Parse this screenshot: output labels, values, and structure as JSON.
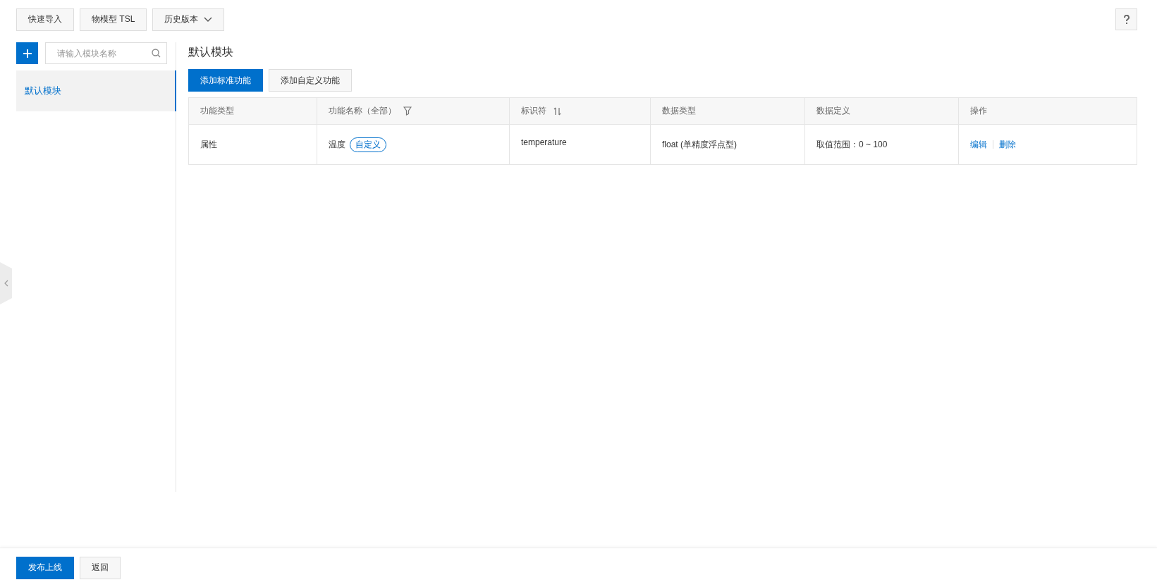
{
  "toolbar": {
    "buttons": [
      {
        "label": "快速导入",
        "kind": "plain"
      },
      {
        "label": "物模型 TSL",
        "kind": "plain"
      },
      {
        "label": "历史版本",
        "kind": "dropdown"
      }
    ]
  },
  "sidebar": {
    "search": {
      "placeholder": "请输入模块名称"
    },
    "items": [
      {
        "label": "默认模块",
        "selected": true
      }
    ]
  },
  "main": {
    "title": "默认模块",
    "actions": [
      {
        "label": "添加标准功能",
        "kind": "primary"
      },
      {
        "label": "添加自定义功能",
        "kind": "plain"
      }
    ],
    "table": {
      "columns": [
        {
          "label": "功能类型",
          "kind": "plain"
        },
        {
          "label": "功能名称（全部）",
          "kind": "filter"
        },
        {
          "label": "标识符",
          "kind": "sort"
        },
        {
          "label": "数据类型",
          "kind": "plain"
        },
        {
          "label": "数据定义",
          "kind": "plain"
        },
        {
          "label": "操作",
          "kind": "plain"
        }
      ],
      "rows": [
        {
          "type": "属性",
          "name": "温度",
          "tag": "自定义",
          "identifier": "temperature",
          "data_type": "float (单精度浮点型)",
          "definition": "取值范围：0 ~ 100",
          "actions": [
            "编辑",
            "删除"
          ]
        }
      ]
    }
  },
  "footer": {
    "buttons": [
      {
        "label": "发布上线",
        "kind": "primary"
      },
      {
        "label": "返回",
        "kind": "plain"
      }
    ]
  }
}
